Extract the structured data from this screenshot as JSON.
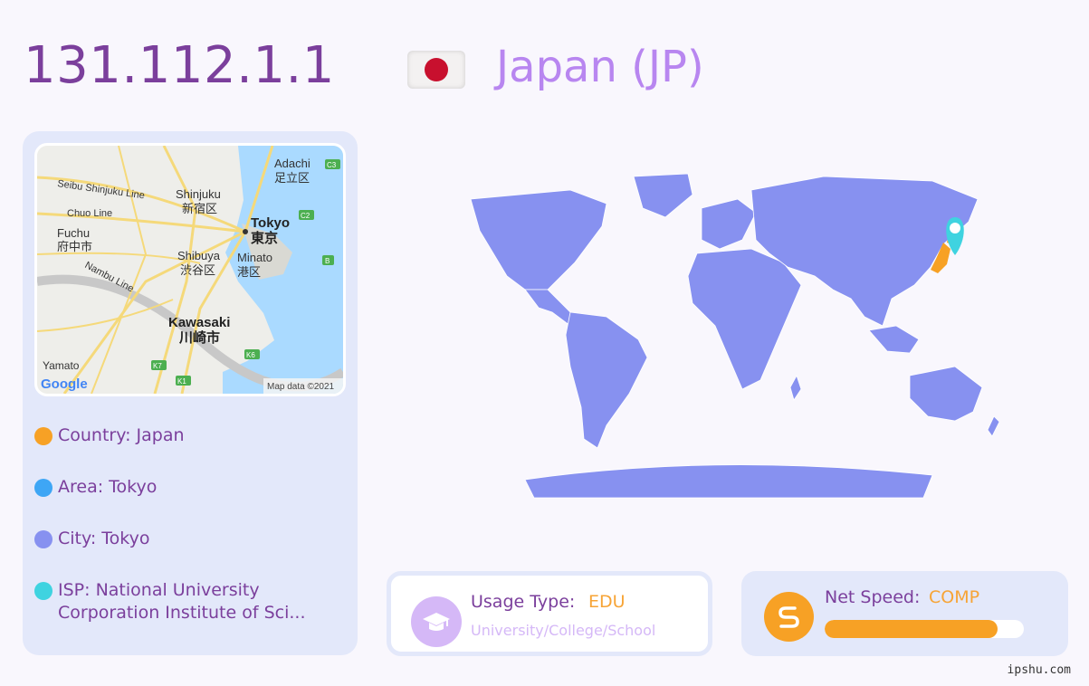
{
  "header": {
    "ip": "131.112.1.1",
    "country_title": "Japan (JP)",
    "flag_icon": "japan-flag-icon"
  },
  "map": {
    "labels": {
      "adachi_en": "Adachi",
      "adachi_jp": "足立区",
      "seibu": "Seibu Shinjuku Line",
      "shinjuku_en": "Shinjuku",
      "shinjuku_jp": "新宿区",
      "chuo": "Chuo Line",
      "tokyo_en": "Tokyo",
      "tokyo_jp": "東京",
      "fuchu_en": "Fuchu",
      "fuchu_jp": "府中市",
      "shibuya_en": "Shibuya",
      "shibuya_jp": "渋谷区",
      "minato_en": "Minato",
      "minato_jp": "港区",
      "nambu": "Nambu Line",
      "kawasaki_en": "Kawasaki",
      "kawasaki_jp": "川崎市",
      "yamato": "Yamato",
      "attribution": "Map data ©2021",
      "google": "Google",
      "c3": "C3",
      "c2": "C2",
      "b": "B",
      "k6": "K6",
      "k7": "K7",
      "k1": "K1"
    }
  },
  "info": {
    "country": "Country: Japan",
    "area": "Area: Tokyo",
    "city": "City: Tokyo",
    "isp": "ISP: National University Corporation Institute of Sci..."
  },
  "colors": {
    "country_dot": "#f7a125",
    "area_dot": "#3ea6f5",
    "city_dot": "#8791f0",
    "isp_dot": "#3fd3e0",
    "world_land": "#8791f0",
    "highlight": "#f7a125",
    "pin": "#3fd3e0"
  },
  "usage": {
    "label": "Usage Type:",
    "value": "EDU",
    "subtitle": "University/College/School",
    "icon": "graduation-cap-icon"
  },
  "speed": {
    "label": "Net Speed:",
    "value": "COMP",
    "level": 0.87,
    "icon": "speed-s-icon"
  },
  "footer": "ipshu.com"
}
